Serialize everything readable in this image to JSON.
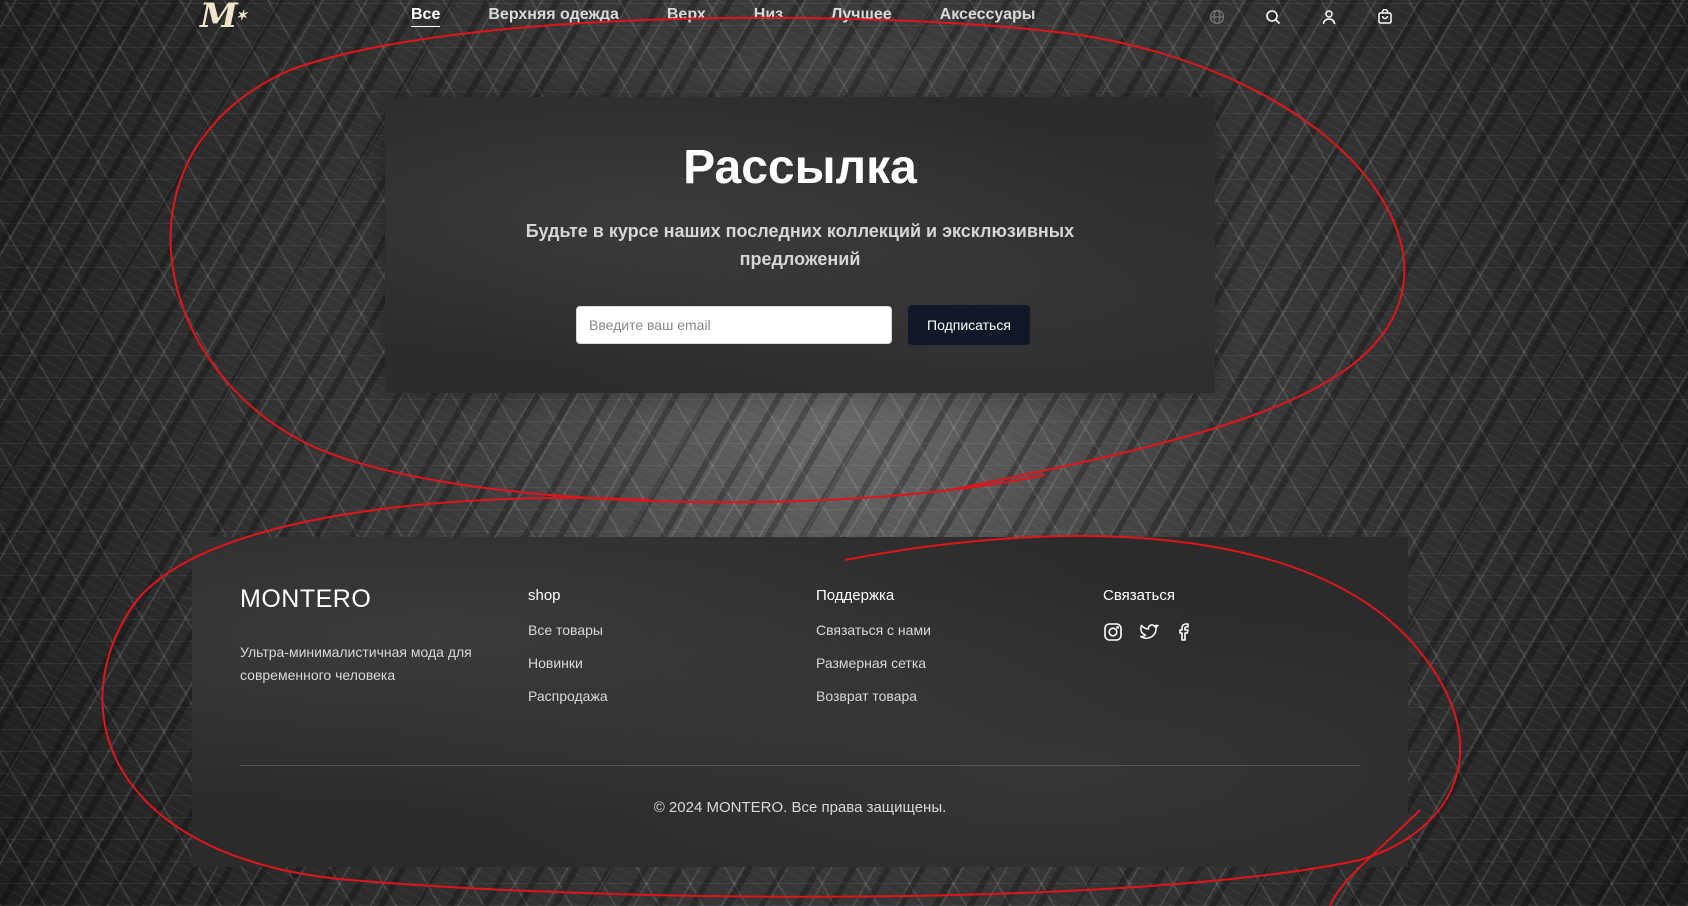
{
  "header": {
    "logo_text": "M",
    "nav": [
      {
        "label": "Все",
        "active": true
      },
      {
        "label": "Верхняя одежда",
        "active": false
      },
      {
        "label": "Верх",
        "active": false
      },
      {
        "label": "Низ",
        "active": false
      },
      {
        "label": "Лучшее",
        "active": false
      },
      {
        "label": "Аксессуары",
        "active": false
      }
    ],
    "icons": [
      "globe-icon",
      "search-icon",
      "user-icon",
      "cart-icon"
    ]
  },
  "newsletter": {
    "title": "Рассылка",
    "subtitle": "Будьте в курсе наших последних коллекций и эксклюзивных предложений",
    "email_placeholder": "Введите ваш email",
    "email_value": "",
    "subscribe_label": "Подписаться"
  },
  "footer": {
    "brand": "MONTERO",
    "tagline": "Ультра-минималистичная мода для современного человека",
    "columns": [
      {
        "title": "shop",
        "links": [
          "Все товары",
          "Новинки",
          "Распродажа"
        ]
      },
      {
        "title": "Поддержка",
        "links": [
          "Связаться с нами",
          "Размерная сетка",
          "Возврат товара"
        ]
      }
    ],
    "connect_title": "Связаться",
    "social_icons": [
      "instagram-icon",
      "twitter-icon",
      "facebook-icon"
    ],
    "copyright": "© 2024 MONTERO. Все права защищены."
  },
  "colors": {
    "annotation": "#e0151b",
    "button_bg": "#111827",
    "logo": "#f1e6c9"
  }
}
